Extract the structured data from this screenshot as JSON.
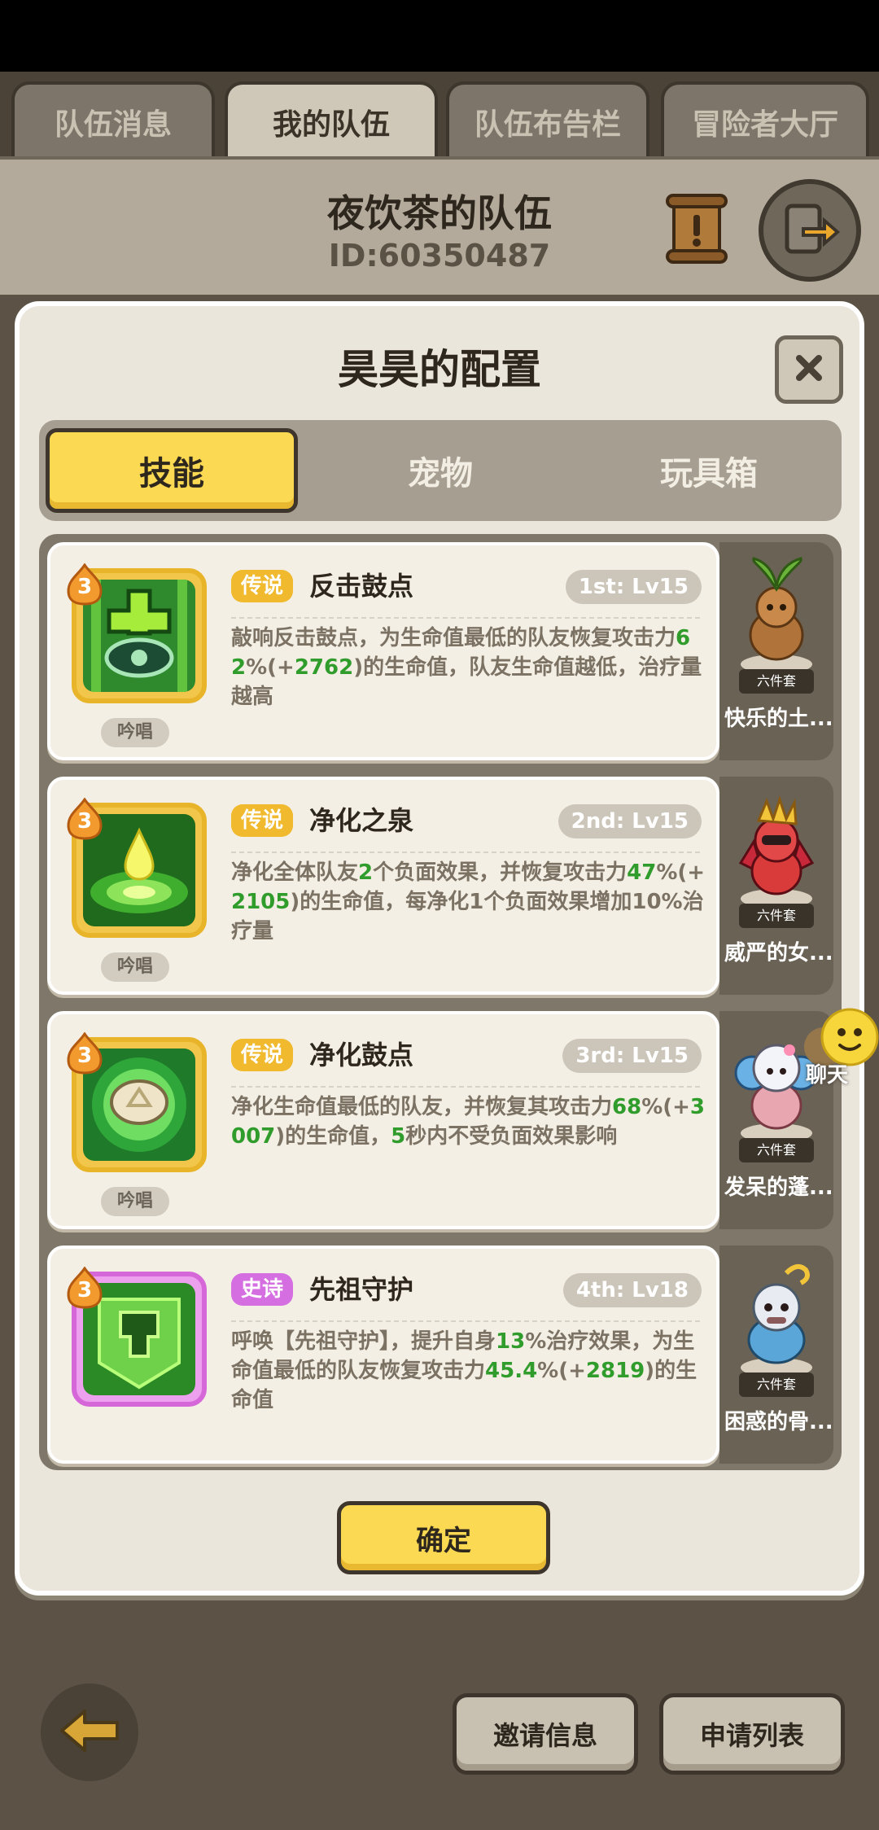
{
  "top_tabs": [
    "队伍消息",
    "我的队伍",
    "队伍布告栏",
    "冒险者大厅"
  ],
  "team": {
    "name": "夜饮茶的队伍",
    "id": "ID:60350487"
  },
  "modal": {
    "title": "昊昊的配置",
    "tabs": [
      "技能",
      "宠物",
      "玩具箱"
    ],
    "active_tab": 0,
    "confirm_label": "确定"
  },
  "skills": [
    {
      "level_badge": "3",
      "rarity": "传说",
      "name": "反击鼓点",
      "slot": "1st: Lv15",
      "cast_tag": "吟唱",
      "desc": "敲响反击鼓点，为生命值最低的队友恢复攻击力",
      "desc_v1": "62",
      "desc_mid": "%(+",
      "desc_v2": "2762",
      "desc_end": ")的生命值，队友生命值越低，治疗量越高",
      "pet_name": "快乐的土...",
      "pet_set": "六件套"
    },
    {
      "level_badge": "3",
      "rarity": "传说",
      "name": "净化之泉",
      "slot": "2nd: Lv15",
      "cast_tag": "吟唱",
      "desc": "净化全体队友",
      "desc_v0": "2",
      "desc_a": "个负面效果，并恢复攻击力",
      "desc_v1": "47",
      "desc_mid": "%(+",
      "desc_v2": "2105",
      "desc_end": ")的生命值，每净化1个负面效果增加10%治疗量",
      "pet_name": "威严的女...",
      "pet_set": "六件套"
    },
    {
      "level_badge": "3",
      "rarity": "传说",
      "name": "净化鼓点",
      "slot": "3rd: Lv15",
      "cast_tag": "吟唱",
      "desc": "净化生命值最低的队友，并恢复其攻击力",
      "desc_v1": "68",
      "desc_mid": "%(+",
      "desc_v2": "3007",
      "desc_a": ")的生命值，",
      "desc_v3": "5",
      "desc_end": "秒内不受负面效果影响",
      "pet_name": "发呆的蓬...",
      "pet_set": "六件套"
    },
    {
      "level_badge": "3",
      "rarity": "史诗",
      "name": "先祖守护",
      "slot": "4th: Lv18",
      "desc": "呼唤【先祖守护】，提升自身",
      "desc_v0": "13",
      "desc_a": "%治疗效果，为生命值最低的队友恢复攻击力",
      "desc_v1": "45.4",
      "desc_mid": "%(+",
      "desc_v2": "2819",
      "desc_end": ")的生命值",
      "pet_name": "困惑的骨...",
      "pet_set": "六件套"
    }
  ],
  "chat_label": "聊天",
  "bottom_buttons": [
    "邀请信息",
    "申请列表"
  ],
  "icons": {
    "scroll": "scroll-icon",
    "exit": "exit-team-icon",
    "close": "close-icon",
    "back": "back-arrow-icon",
    "chat": "chat-emoji-icon"
  }
}
